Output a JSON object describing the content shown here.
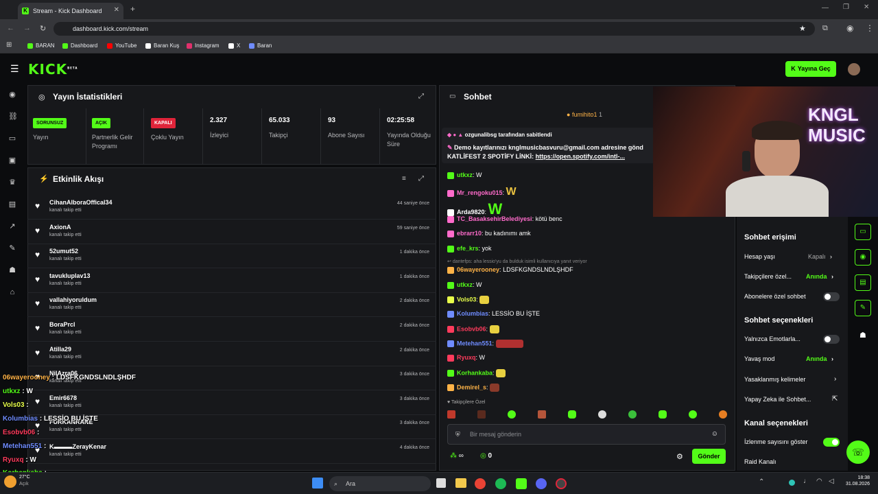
{
  "browser": {
    "tab_title": "Stream - Kick Dashboard",
    "url": "dashboard.kick.com/stream",
    "bookmarks": [
      {
        "label": "BARAN",
        "color": "#53fc18"
      },
      {
        "label": "Dashboard",
        "color": "#53fc18"
      },
      {
        "label": "YouTube",
        "color": "#ff0000"
      },
      {
        "label": "Baran Kuş",
        "color": "#ffffff"
      },
      {
        "label": "Instagram",
        "color": "#e1306c"
      },
      {
        "label": "X",
        "color": "#ffffff"
      },
      {
        "label": "Baran",
        "color": "#6f8cff"
      }
    ]
  },
  "header": {
    "logo": "KICK",
    "logo_sup": "BETA",
    "go_live": "Yayına Geç"
  },
  "stats": {
    "title": "Yayın İstatistikleri",
    "items": [
      {
        "badge": "SORUNSUZ",
        "badge_color": "#53fc18",
        "label": "Yayın"
      },
      {
        "badge": "AÇIK",
        "badge_color": "#53fc18",
        "label": "Partnerlik Gelir Programı"
      },
      {
        "badge": "KAPALI",
        "badge_color": "#e0243a",
        "label": "Çoklu Yayın"
      },
      {
        "value": "2.327",
        "label": "İzleyici"
      },
      {
        "value": "65.033",
        "label": "Takipçi"
      },
      {
        "value": "93",
        "label": "Abone Sayısı"
      },
      {
        "value": "02:25:58",
        "label": "Yayında Olduğu Süre"
      }
    ]
  },
  "activity": {
    "title": "Etkinlik Akışı",
    "events": [
      {
        "name": "CihanAlboraOffical34",
        "sub": "kanalı takip etti",
        "time": "44 saniye önce"
      },
      {
        "name": "AxionA",
        "sub": "kanalı takip etti",
        "time": "59 saniye önce"
      },
      {
        "name": "52umut52",
        "sub": "kanalı takip etti",
        "time": "1 dakika önce"
      },
      {
        "name": "tavukluplav13",
        "sub": "kanalı takip etti",
        "time": "1 dakika önce"
      },
      {
        "name": "vallahiyoruldum",
        "sub": "kanalı takip etti",
        "time": "2 dakika önce"
      },
      {
        "name": "BoraPrcl",
        "sub": "kanalı takip etti",
        "time": "2 dakika önce"
      },
      {
        "name": "Atilla29",
        "sub": "kanalı takip etti",
        "time": "2 dakika önce"
      },
      {
        "name": "NilAzra06",
        "sub": "kanalı takip etti",
        "time": "3 dakika önce"
      },
      {
        "name": "Emir6678",
        "sub": "kanalı takip etti",
        "time": "3 dakika önce"
      },
      {
        "name": "FURKANRANE",
        "sub": "kanalı takip etti",
        "time": "3 dakika önce"
      },
      {
        "name": "K▬▬▬ZerayKenar",
        "sub": "kanalı takip etti",
        "time": "4 dakika önce"
      }
    ]
  },
  "chat": {
    "title": "Sohbet",
    "top_gifter": "fumihito1",
    "top_gifter_count": "1",
    "pinned_by": "ozgunalibsg tarafından sabitlendi",
    "pinned_line1": "Demo kayıtlarınızı knglmusicbasvuru@gmail.com adresine gönd",
    "pinned_line2_prefix": "KATLİFEST 2 SPOTİFY LİNKİ: ",
    "pinned_link": "https://open.spotify.com/intl-...",
    "reply_note": "dantefps: aha lessio'yu da bulduk isimli kullanıcıya yanıt veriyor",
    "messages": [
      {
        "user": "utkxz",
        "color": "#53fc18",
        "text": "W"
      },
      {
        "user": "Mr_rengoku015",
        "color": "#ff6bcb",
        "text": "W"
      },
      {
        "user": "Arda9820",
        "color": "#ffffff",
        "text": "W"
      },
      {
        "user": "TC_BasaksehirBelediyesi",
        "color": "#ff6bcb",
        "text": "kötü benc"
      },
      {
        "user": "ebrarr10",
        "color": "#ff6bcb",
        "text": "bu kadınımı amk"
      },
      {
        "user": "efe_krs",
        "color": "#53fc18",
        "text": "yok"
      },
      {
        "user": "06wayerooney",
        "color": "#ffb347",
        "text": "LDSFKGNDSLNDLŞHDF"
      },
      {
        "user": "utkxz",
        "color": "#53fc18",
        "text": "W"
      },
      {
        "user": "Vols03",
        "color": "#e8ff4a",
        "text": ""
      },
      {
        "user": "Kolumbias",
        "color": "#6f8cff",
        "text": "LESSİO BU İŞTE"
      },
      {
        "user": "Esobvb06",
        "color": "#ff3b5c",
        "text": ""
      },
      {
        "user": "Metehan551",
        "color": "#6f8cff",
        "text": ""
      },
      {
        "user": "Ryuxq",
        "color": "#ff3b5c",
        "text": "W"
      },
      {
        "user": "Korhankaba",
        "color": "#53fc18",
        "text": ""
      },
      {
        "user": "Demirel_s",
        "color": "#ffb347",
        "text": ""
      }
    ],
    "followers_only": "Takipçilere Özel",
    "input_placeholder": "Bir mesaj gönderin",
    "points": "∞",
    "kicks": "0",
    "send": "Gönder"
  },
  "overlay_chat": [
    {
      "user": "06wayerooney",
      "color": "#ffb347",
      "text": "LDSFKGNDSLNDLŞHDF"
    },
    {
      "user": "utkxz",
      "color": "#53fc18",
      "text": "W"
    },
    {
      "user": "Vols03",
      "color": "#e8ff4a",
      "text": ""
    },
    {
      "user": "Kolumbias",
      "color": "#6f8cff",
      "text": "LESSİO BU İŞTE"
    },
    {
      "user": "Esobvb06",
      "color": "#ff3b5c",
      "text": ""
    },
    {
      "user": "Metehan551",
      "color": "#6f8cff",
      "text": ""
    },
    {
      "user": "Ryuxq",
      "color": "#ff3b5c",
      "text": "W"
    },
    {
      "user": "Korhankaba",
      "color": "#53fc18",
      "text": ""
    },
    {
      "user": "Demirel_s",
      "color": "#ffb347",
      "text": ""
    }
  ],
  "settings": {
    "access_title": "Sohbet erişimi",
    "account_age": "Hesap yaşı",
    "account_age_val": "Kapalı",
    "followers_only": "Takipçilere özel...",
    "followers_only_val": "Anında",
    "subs_only": "Abonelere özel sohbet",
    "options_title": "Sohbet seçenekleri",
    "emotes_only": "Yalnızca Emotlarla...",
    "slow_mode": "Yavaş mod",
    "slow_mode_val": "Anında",
    "banned_words": "Yasaklanmış kelimeler",
    "ai_chat": "Yapay Zeka ile Sohbet...",
    "channel_title": "Kanal seçenekleri",
    "show_viewers": "İzlenme sayısını göster",
    "raid": "Raid Kanalı"
  },
  "webcam": {
    "sign_line1": "KNGL",
    "sign_line2": "MUSIC"
  },
  "taskbar": {
    "search": "Ara",
    "temp": "27°C",
    "weather": "Açık",
    "time": "18:38",
    "date": "31.08.2026"
  }
}
